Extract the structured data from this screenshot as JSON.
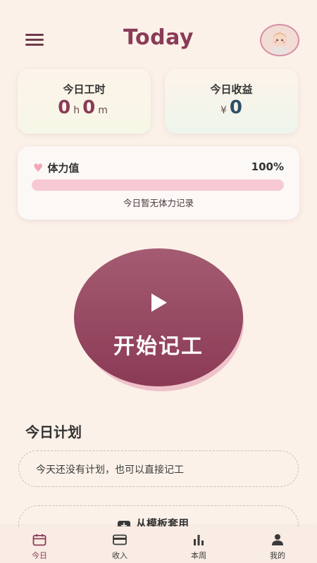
{
  "header": {
    "title": "Today"
  },
  "hours_card": {
    "label": "今日工时",
    "hours": "0",
    "hours_unit": "h",
    "minutes": "0",
    "minutes_unit": "m"
  },
  "income_card": {
    "label": "今日收益",
    "currency": "¥",
    "amount": "0"
  },
  "stamina": {
    "label": "体力值",
    "percent_text": "100%",
    "percent": 100,
    "note": "今日暂无体力记录"
  },
  "start_button": {
    "label": "开始记工"
  },
  "plan": {
    "title": "今日计划",
    "empty_text": "今天还没有计划，也可以直接记工",
    "template_label": "从模板套用"
  },
  "tabs": [
    {
      "label": "今日",
      "icon": "calendar-icon"
    },
    {
      "label": "收入",
      "icon": "card-icon"
    },
    {
      "label": "本周",
      "icon": "bar-chart-icon"
    },
    {
      "label": "我的",
      "icon": "user-icon"
    }
  ],
  "colors": {
    "accent": "#8a3b57",
    "background": "#fbf1e9",
    "stamina_bar": "#f7c9d4"
  }
}
